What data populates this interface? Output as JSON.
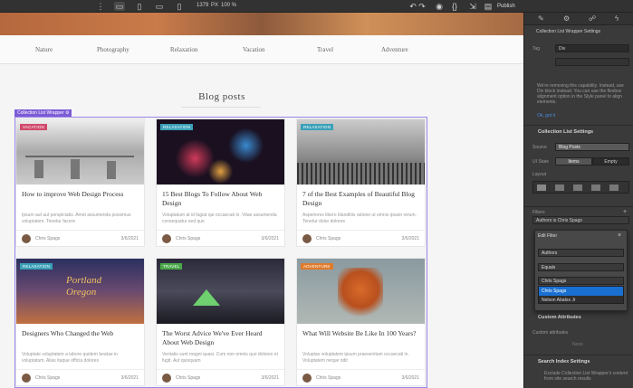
{
  "toolbar": {
    "width_value": "1379",
    "width_unit": "PX",
    "zoom": "100 %",
    "publish_label": "Publish",
    "icons": [
      "ellipsis-icon",
      "desktop-icon",
      "tablet-icon",
      "tablet-landscape-icon",
      "phone-icon",
      "undo-icon",
      "redo-icon",
      "preview-icon",
      "code-icon",
      "share-icon"
    ]
  },
  "site": {
    "nav": [
      "Nature",
      "Photography",
      "Relaxation",
      "Vacation",
      "Travel",
      "Adventure"
    ],
    "blog_heading": "Blog posts",
    "collection_label": "Collection List Wrapper",
    "posts": [
      {
        "tag": "VACATION",
        "tag_color": "#d04a6a",
        "title": "How to improve Web Design Process",
        "excerpt": "Ipsum aut aut perspiciatis. Amet assumenda possimus voluptatem. Tenetur facere",
        "author": "Chris Spags",
        "date": "3/6/2021"
      },
      {
        "tag": "RELAXATION",
        "tag_color": "#3aa0b8",
        "title": "15 Best Blogs To Follow About Web Design",
        "excerpt": "Voluptatum at id fugiat qui occaecati in. Vitae assumenda consequatur sed quo",
        "author": "Chris Spags",
        "date": "3/6/2021"
      },
      {
        "tag": "RELAXATION",
        "tag_color": "#3aa0b8",
        "title": "7 of the Best Examples of Beautiful Blog Design",
        "excerpt": "Asperiores libero blanditiis ratione ut omnis ipsam rerum. Tenetur dolor dolores",
        "author": "Chris Spags",
        "date": "3/6/2021"
      },
      {
        "tag": "RELAXATION",
        "tag_color": "#3aa0b8",
        "title": "Designers Who Changed the Web",
        "excerpt": "Voluptate voluptatem a labore quidem beatae in voluptatum. Alias itaque officia dolores",
        "author": "Chris Spags",
        "date": "3/6/2021"
      },
      {
        "tag": "TRAVEL",
        "tag_color": "#4aa84a",
        "title": "The Worst Advice We've Ever Heard About Web Design",
        "excerpt": "Ventatis sunt magni quasi. Cum non omnis quo dolores et fugit. Aut quisquam",
        "author": "Chris Spags",
        "date": "3/6/2021"
      },
      {
        "tag": "ADVENTURE",
        "tag_color": "#e07a2a",
        "title": "What Will Website Be Like In 100 Years?",
        "excerpt": "Voluptas voluptatem ipsum praesentium occaecati in. Voluptatem neque odit",
        "author": "Chris Spags",
        "date": "3/6/2021"
      }
    ]
  },
  "panel": {
    "header": "Collection List Wrapper Settings",
    "tag_label": "Tag",
    "tag_value": "Div",
    "warning": "We're removing this capability. Instead, use Div block instead. You can use the flexbox alignment option in the Style panel to align elements.",
    "got_it": "Ok, got it",
    "list_settings_title": "Collection List Settings",
    "source_label": "Source",
    "source_value": "Blog Posts",
    "ui_state_label": "UI State",
    "ui_state_options": [
      "Items",
      "Empty"
    ],
    "layout_label": "Layout",
    "filters_label": "Filters",
    "filter_value": "Authors is Chris Spags",
    "custom_attributes": "Custom Attributes",
    "custom_attributes_sub": "Custom attributes",
    "none_label": "None",
    "search_index": "Search Index Settings",
    "search_text": "Exclude Collection List Wrapper's content from site search results"
  },
  "edit_filter": {
    "title": "Edit Filter",
    "field": "Authors",
    "operator": "Equals",
    "value": "Chris Spags",
    "options": [
      "Chris Spags",
      "Nelson Abalos Jr"
    ],
    "selected": "Chris Spags"
  }
}
